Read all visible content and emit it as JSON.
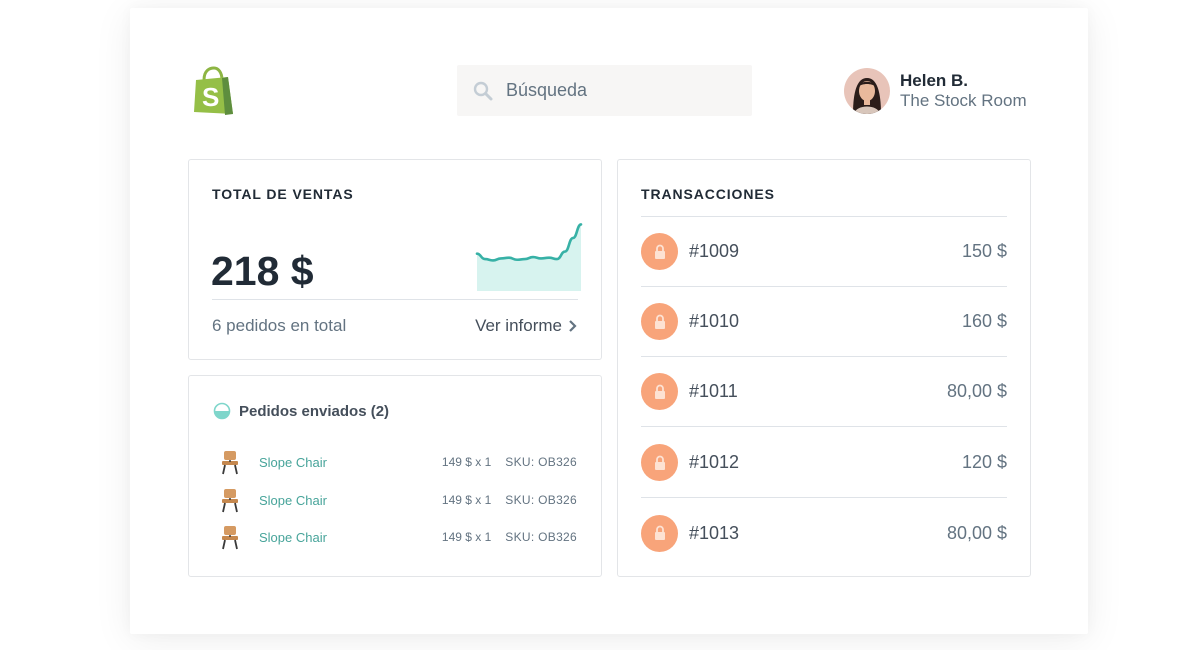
{
  "header": {
    "logo_icon": "shopify-bag-icon",
    "search": {
      "placeholder": "Búsqueda",
      "icon": "search-icon"
    },
    "user": {
      "name": "Helen B.",
      "store": "The Stock Room"
    }
  },
  "sales_card": {
    "title": "TOTAL DE VENTAS",
    "amount": "218 $",
    "orders_summary": "6 pedidos en total",
    "report_link": "Ver informe",
    "sparkline_values": [
      52,
      44,
      42,
      45,
      46,
      43,
      44,
      47,
      45,
      46,
      44,
      55,
      75,
      95
    ],
    "accent_color": "#37b1a6"
  },
  "orders_card": {
    "title": "Pedidos enviados (2)",
    "items": [
      {
        "product": "Slope Chair",
        "price": "149 $ x 1",
        "sku": "SKU: OB326"
      },
      {
        "product": "Slope Chair",
        "price": "149 $ x 1",
        "sku": "SKU: OB326"
      },
      {
        "product": "Slope Chair",
        "price": "149 $ x 1",
        "sku": "SKU: OB326"
      }
    ]
  },
  "transactions_card": {
    "title": "TRANSACCIONES",
    "icon_color": "#f8a47a",
    "rows": [
      {
        "id": "#1009",
        "amount": "150 $"
      },
      {
        "id": "#1010",
        "amount": "160 $"
      },
      {
        "id": "#1011",
        "amount": "80,00 $"
      },
      {
        "id": "#1012",
        "amount": "120 $"
      },
      {
        "id": "#1013",
        "amount": "80,00 $"
      }
    ]
  }
}
